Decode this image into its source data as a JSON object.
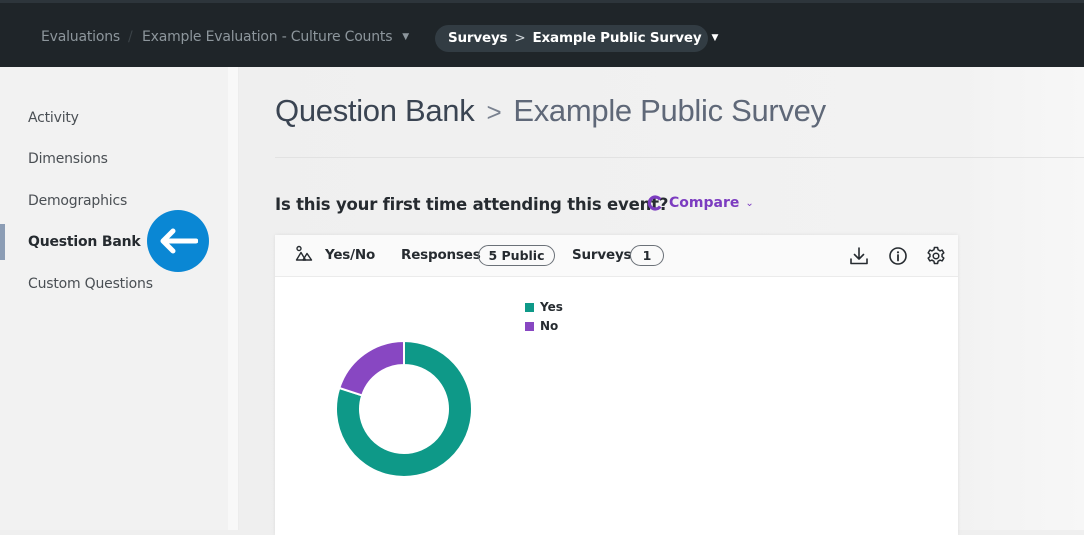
{
  "topbar": {
    "breadcrumb": [
      {
        "label": "Evaluations"
      },
      {
        "label": "Example Evaluation - Culture Counts",
        "has_dropdown": true
      }
    ],
    "separator": "/",
    "survey_pill": {
      "parent": "Surveys",
      "separator": ">",
      "current": "Example Public Survey",
      "has_dropdown": true
    }
  },
  "sidebar": {
    "items": [
      {
        "label": "Activity",
        "active": false
      },
      {
        "label": "Dimensions",
        "active": false
      },
      {
        "label": "Demographics",
        "active": false
      },
      {
        "label": "Question Bank",
        "active": true
      },
      {
        "label": "Custom Questions",
        "active": false
      }
    ],
    "callout_icon": "arrow-left-icon"
  },
  "page": {
    "title_parent": "Question Bank",
    "title_separator": ">",
    "title_current": "Example Public Survey"
  },
  "question": {
    "text": "Is this your first time attending this event?",
    "compare_label": "Compare",
    "compare_icon": "ring-icon",
    "accent_color": "#7c3cc0"
  },
  "card": {
    "type_icon": "shapes-icon",
    "type_label": "Yes/No",
    "responses_label": "Responses",
    "responses_badge": "5 Public",
    "surveys_label": "Surveys",
    "surveys_badge": "1",
    "actions": [
      "download-icon",
      "info-icon",
      "gear-icon"
    ]
  },
  "chart_data": {
    "type": "pie",
    "variant": "donut",
    "title": "",
    "categories": [
      "Yes",
      "No"
    ],
    "values": [
      4,
      1
    ],
    "percent": [
      80,
      20
    ],
    "colors": [
      "#0e9988",
      "#8847c2"
    ],
    "legend": [
      "Yes",
      "No"
    ],
    "legend_position": "top-right"
  }
}
